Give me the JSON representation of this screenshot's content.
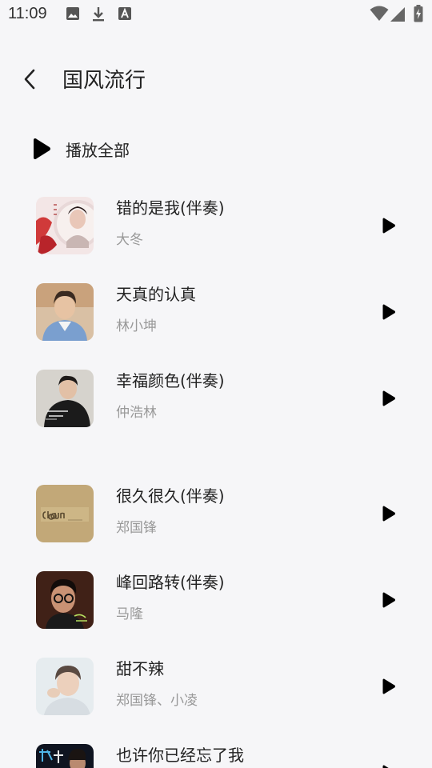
{
  "status_bar": {
    "time": "11:09",
    "left_icons": [
      "image-icon",
      "download-icon",
      "font-icon"
    ],
    "right_icons": [
      "wifi-icon",
      "signal-icon",
      "battery-charging-icon"
    ]
  },
  "header": {
    "title": "国风流行",
    "back_icon": "chevron-left-icon"
  },
  "play_all": {
    "label": "播放全部",
    "icon": "play-icon"
  },
  "songs": [
    {
      "title": "错的是我(伴奏)",
      "artist": "大冬",
      "cover": "red-white-portrait"
    },
    {
      "title": "天真的认真",
      "artist": "林小坤",
      "cover": "boy-denim-jacket"
    },
    {
      "title": "幸福颜色(伴奏)",
      "artist": "仲浩林",
      "cover": "man-black-shirt"
    },
    {
      "title": "很久很久(伴奏)",
      "artist": "郑国锋",
      "cover": "clown-text-gold"
    },
    {
      "title": "峰回路转(伴奏)",
      "artist": "马隆",
      "cover": "man-glasses-dark"
    },
    {
      "title": "甜不辣",
      "artist": "郑国锋、小凌",
      "cover": "boy-light-background"
    },
    {
      "title": "也许你已经忘了我",
      "artist": "",
      "cover": "dark-poster"
    }
  ],
  "colors": {
    "background": "#f6f6f8",
    "text_primary": "#222222",
    "text_secondary": "#999999",
    "icon": "#000000"
  }
}
